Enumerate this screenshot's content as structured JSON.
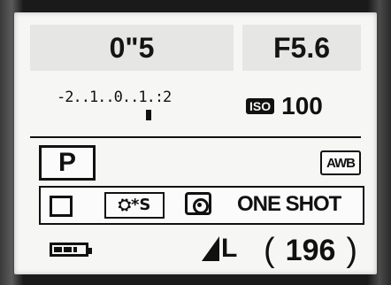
{
  "camera": {
    "shutter_speed": "0\"5",
    "aperture": "F5.6",
    "exposure_scale": "-2..1..0..1.:2",
    "iso_label": "ISO",
    "iso_value": "100",
    "mode": "P",
    "white_balance": "AWB",
    "picture_style": "⛭*S",
    "af_mode": "ONE SHOT",
    "quality": "L",
    "shots_remaining": "196",
    "battery_level_fraction": 0.75
  },
  "icons": {
    "drive": "single-shot-icon",
    "metering": "evaluative-metering-icon",
    "battery": "battery-icon",
    "quality": "quality-large-icon"
  }
}
